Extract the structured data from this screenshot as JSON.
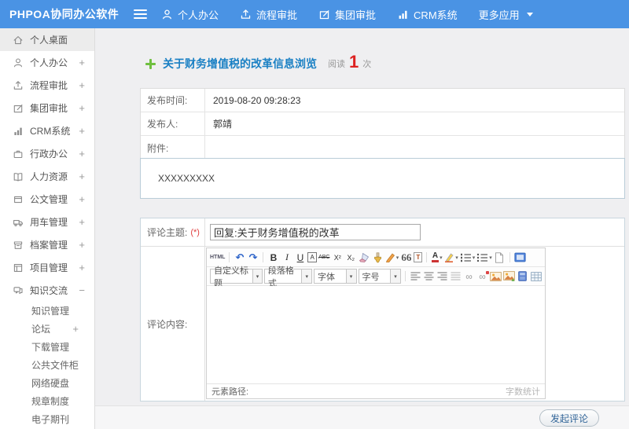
{
  "colors": {
    "header_blue": "#4a93e4",
    "title_blue": "#1a80c4",
    "count_red": "#dd2222",
    "plus_green": "#6fbf3f",
    "button_text_blue": "#336699"
  },
  "header": {
    "logo": "PHPOA协同办公软件",
    "nav": [
      {
        "label": "个人办公"
      },
      {
        "label": "流程审批"
      },
      {
        "label": "集团审批"
      },
      {
        "label": "CRM系统"
      }
    ],
    "more_label": "更多应用"
  },
  "sidebar": {
    "items": [
      {
        "label": "个人桌面",
        "expander": ""
      },
      {
        "label": "个人办公",
        "expander": "+"
      },
      {
        "label": "流程审批",
        "expander": "+"
      },
      {
        "label": "集团审批",
        "expander": "+"
      },
      {
        "label": "CRM系统",
        "expander": "+"
      },
      {
        "label": "行政办公",
        "expander": "+"
      },
      {
        "label": "人力资源",
        "expander": "+"
      },
      {
        "label": "公文管理",
        "expander": "+"
      },
      {
        "label": "用车管理",
        "expander": "+"
      },
      {
        "label": "档案管理",
        "expander": "+"
      },
      {
        "label": "项目管理",
        "expander": "+"
      },
      {
        "label": "知识交流",
        "expander": "−"
      }
    ],
    "subitems": [
      {
        "label": "知识管理",
        "expander": ""
      },
      {
        "label": "论坛",
        "expander": "+"
      },
      {
        "label": "下载管理",
        "expander": ""
      },
      {
        "label": "公共文件柜",
        "expander": ""
      },
      {
        "label": "网络硬盘",
        "expander": ""
      },
      {
        "label": "规章制度",
        "expander": ""
      },
      {
        "label": "电子期刊",
        "expander": ""
      }
    ]
  },
  "main": {
    "title": "关于财务增值税的改革信息浏览",
    "read_label": "阅读",
    "read_count": "1",
    "read_unit": "次",
    "info": {
      "publish_time_label": "发布时间:",
      "publish_time": "2019-08-20 09:28:23",
      "publisher_label": "发布人:",
      "publisher": "郭靖",
      "attachment_label": "附件:",
      "content": "XXXXXXXXX"
    },
    "comment": {
      "subject_label": "评论主题:",
      "required_mark": "(*)",
      "subject_value": "回复:关于财务增值税的改革",
      "content_label": "评论内容:",
      "editor": {
        "selects": [
          {
            "label": "自定义标题"
          },
          {
            "label": "段落格式"
          },
          {
            "label": "字体"
          },
          {
            "label": "字号"
          }
        ],
        "element_path": "元素路径:",
        "word_count": "字数统计"
      }
    },
    "submit_button": "发起评论"
  },
  "icons": {
    "caret": "▾",
    "html": "HTML",
    "undo": "↶",
    "redo": "↷",
    "bold": "B",
    "italic": "I",
    "underline": "U",
    "fontborder": "A",
    "strikethrough": "ABC",
    "superscript": "X²",
    "subscript": "X₂",
    "blockquote": "66",
    "pastetext": "T",
    "forecolor": "A",
    "link": "∞",
    "unlink": "∞"
  }
}
